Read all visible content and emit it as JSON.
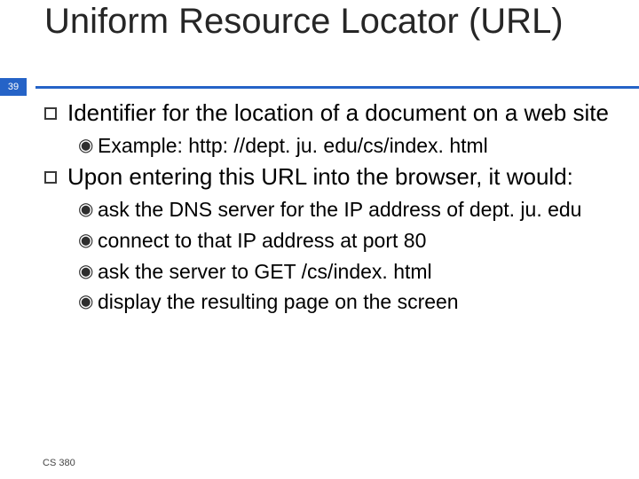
{
  "slide_number": "39",
  "title": "Uniform Resource Locator (URL)",
  "bullets": {
    "b1": "Identifier for the location of a document on a web site",
    "b1_1": "Example: http: //dept. ju. edu/cs/index. html",
    "b2": "Upon entering this URL into the browser, it would:",
    "b2_1": "ask the DNS server for the IP address of dept. ju. edu",
    "b2_2": "connect to that IP address at port 80",
    "b2_3": "ask the server to GET /cs/index. html",
    "b2_4": "display the resulting page on the screen"
  },
  "footer": "CS 380"
}
